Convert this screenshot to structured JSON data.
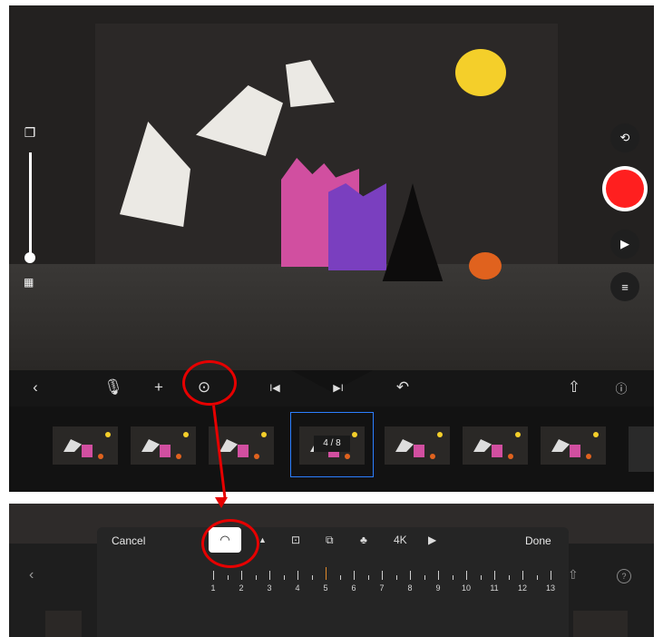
{
  "top": {
    "toolbar": {
      "back_icon": "chevron-left-icon",
      "mic_icon": "microphone-icon",
      "add_icon": "plus-icon",
      "playback_settings_icon": "speedometer-icon",
      "prev_frame_icon": "skip-back-icon",
      "next_frame_icon": "skip-forward-icon",
      "undo_icon": "undo-icon",
      "share_icon": "share-icon",
      "help_icon": "help-icon"
    },
    "right_controls": {
      "timer_icon": "timer-icon",
      "record_color": "#ff1f1f",
      "play_icon": "play-icon",
      "settings_icon": "sliders-icon"
    },
    "left_controls": {
      "onion_skin_icon": "layers-icon",
      "grid_icon": "grid-icon",
      "opacity_level": 0.15
    },
    "filmstrip": {
      "frame_count": 7,
      "selected_index": 3,
      "selected_label": "4 / 8"
    }
  },
  "bottom": {
    "cancel": "Cancel",
    "done": "Done",
    "segments": [
      "speedometer-icon",
      "aspect-icon",
      "overlay-icon",
      "color-icon",
      "4K",
      "video-icon"
    ],
    "ruler_labels": [
      "1",
      "2",
      "3",
      "4",
      "5",
      "6",
      "7",
      "8",
      "9",
      "10",
      "11",
      "12",
      "13"
    ],
    "selected_value_index": 4
  },
  "annotation": {
    "color": "#e60000"
  }
}
